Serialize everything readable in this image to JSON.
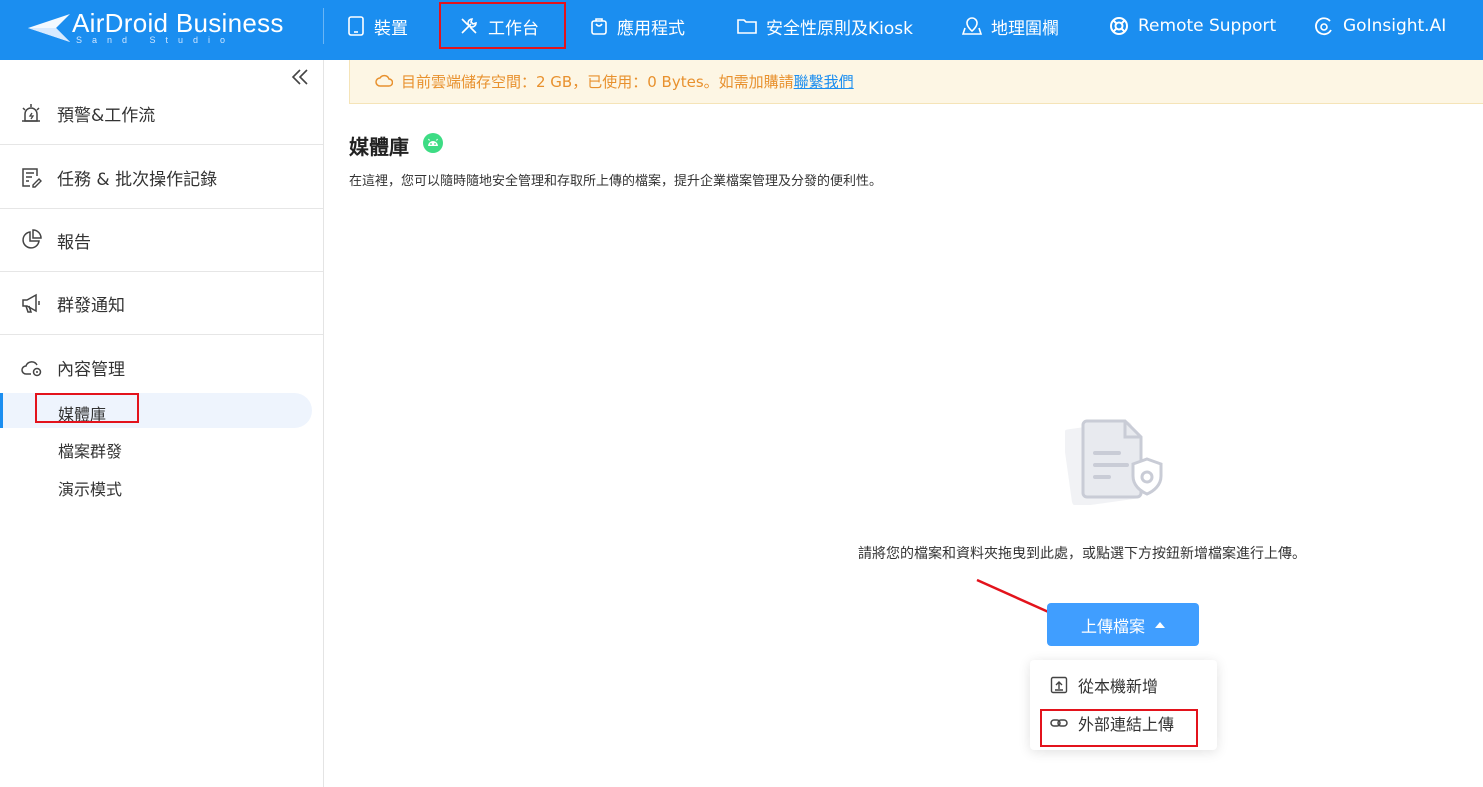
{
  "brand": {
    "name": "AirDroid Business",
    "sub": "Sand Studio"
  },
  "nav": {
    "items": [
      {
        "label": "裝置"
      },
      {
        "label": "工作台"
      },
      {
        "label": "應用程式"
      },
      {
        "label": "安全性原則及Kiosk"
      },
      {
        "label": "地理圍欄"
      },
      {
        "label": "Remote Support"
      },
      {
        "label": "GoInsight.AI"
      }
    ],
    "active": "工作台"
  },
  "sidebar": {
    "groups": [
      {
        "label": "預警&工作流"
      },
      {
        "label": "任務 & 批次操作記錄"
      },
      {
        "label": "報告"
      },
      {
        "label": "群發通知"
      },
      {
        "label": "內容管理"
      }
    ],
    "sub_items": [
      {
        "label": "媒體庫"
      },
      {
        "label": "檔案群發"
      },
      {
        "label": "演示模式"
      }
    ],
    "active_sub": "媒體庫"
  },
  "banner": {
    "text": "目前雲端儲存空間：2 GB，已使用：0 Bytes。如需加購請",
    "link": "聯繫我們"
  },
  "page": {
    "title": "媒體庫",
    "description": "在這裡，您可以隨時隨地安全管理和存取所上傳的檔案，提升企業檔案管理及分發的便利性。",
    "empty_text": "請將您的檔案和資料夾拖曳到此處，或點選下方按鈕新增檔案進行上傳。"
  },
  "upload": {
    "button_label": "上傳檔案",
    "menu": [
      {
        "label": "從本機新增"
      },
      {
        "label": "外部連結上傳"
      }
    ]
  },
  "colors": {
    "primary": "#1b8ef0",
    "button": "#409eff",
    "highlight": "#e3131c",
    "banner_text": "#e8912e"
  }
}
